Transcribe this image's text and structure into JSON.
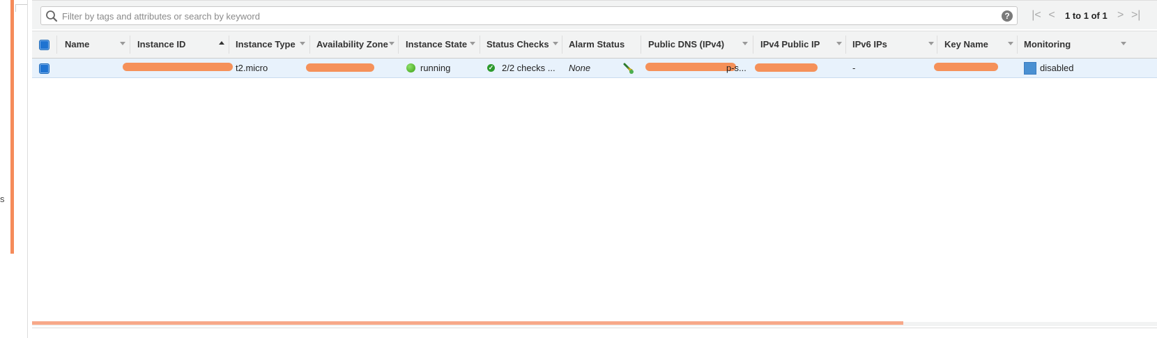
{
  "search": {
    "placeholder": "Filter by tags and attributes or search by keyword",
    "value": ""
  },
  "pagination": {
    "text": "1 to 1 of 1"
  },
  "left_panel": {
    "char": "s"
  },
  "columns": [
    {
      "label": "Name"
    },
    {
      "label": "Instance ID"
    },
    {
      "label": "Instance Type"
    },
    {
      "label": "Availability Zone"
    },
    {
      "label": "Instance State"
    },
    {
      "label": "Status Checks"
    },
    {
      "label": "Alarm Status"
    },
    {
      "label": "Public DNS (IPv4)"
    },
    {
      "label": "IPv4 Public IP"
    },
    {
      "label": "IPv6 IPs"
    },
    {
      "label": "Key Name"
    },
    {
      "label": "Monitoring"
    }
  ],
  "row": {
    "name": "",
    "instance_type": "t2.micro",
    "instance_state": "running",
    "status_checks": "2/2 checks ...",
    "alarm_status": "None",
    "public_dns_suffix": "p-s...",
    "ipv6_ips": "-",
    "monitoring": "disabled"
  },
  "colors": {
    "accent_blue": "#1f73d1",
    "redaction": "#f5915a",
    "running_green": "#3aa012"
  },
  "icons": {
    "search": "search-icon",
    "help": "help-icon",
    "alarm": "alarm-icon",
    "monitoring": "monitoring-square-icon"
  }
}
